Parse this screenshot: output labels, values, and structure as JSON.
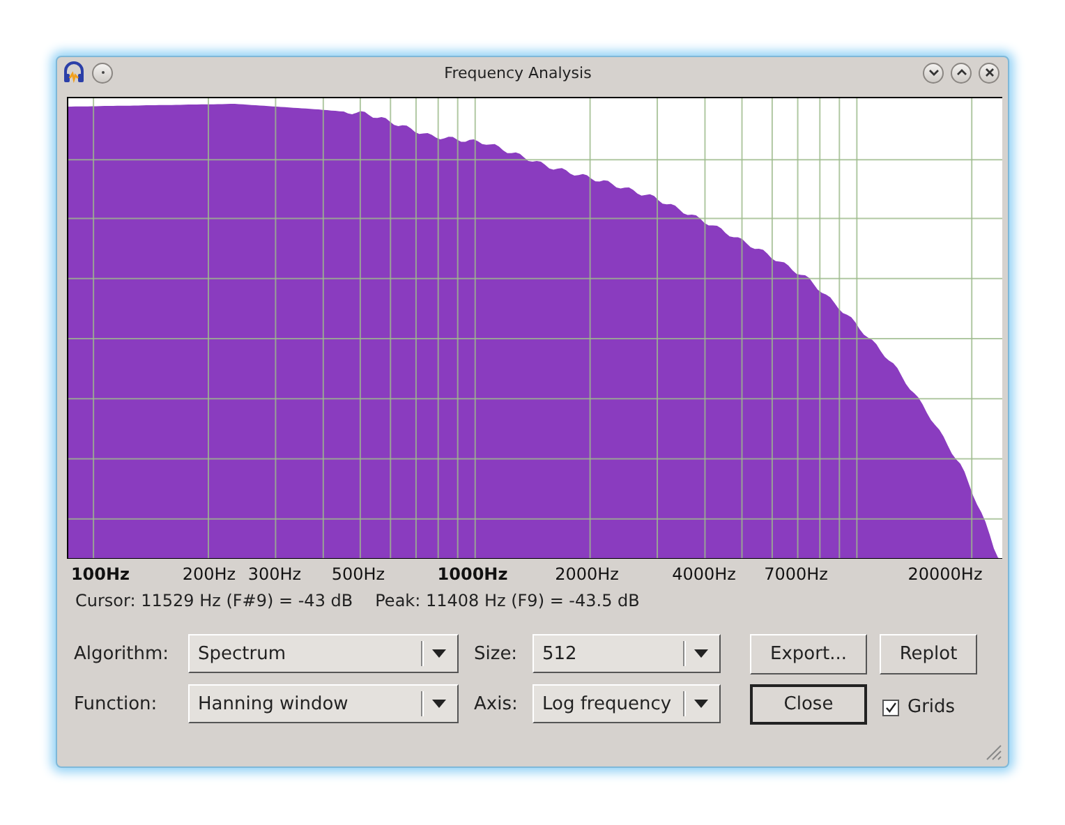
{
  "window": {
    "title": "Frequency Analysis"
  },
  "plot": {
    "x_labels": [
      {
        "text": "100Hz",
        "major": true
      },
      {
        "text": "200Hz",
        "major": false
      },
      {
        "text": "300Hz",
        "major": false
      },
      {
        "text": "500Hz",
        "major": false
      },
      {
        "text": "1000Hz",
        "major": true
      },
      {
        "text": "2000Hz",
        "major": false
      },
      {
        "text": "4000Hz",
        "major": false
      },
      {
        "text": "7000Hz",
        "major": false
      },
      {
        "text": "20000Hz",
        "major": false
      }
    ]
  },
  "readout": {
    "cursor": "Cursor: 11529 Hz (F#9) = -43 dB",
    "peak": "Peak: 11408 Hz (F9) = -43.5 dB"
  },
  "controls": [
    {
      "label": "Algorithm:",
      "value": "Spectrum"
    },
    {
      "label": "Size:",
      "value": "512"
    },
    {
      "label": "Function:",
      "value": "Hanning window"
    },
    {
      "label": "Axis:",
      "value": "Log frequency"
    }
  ],
  "buttons": [
    {
      "label": "Export...",
      "default": false
    },
    {
      "label": "Replot",
      "default": false
    },
    {
      "label": "Close",
      "default": true
    }
  ],
  "grids": {
    "label": "Grids",
    "checked": true
  }
}
